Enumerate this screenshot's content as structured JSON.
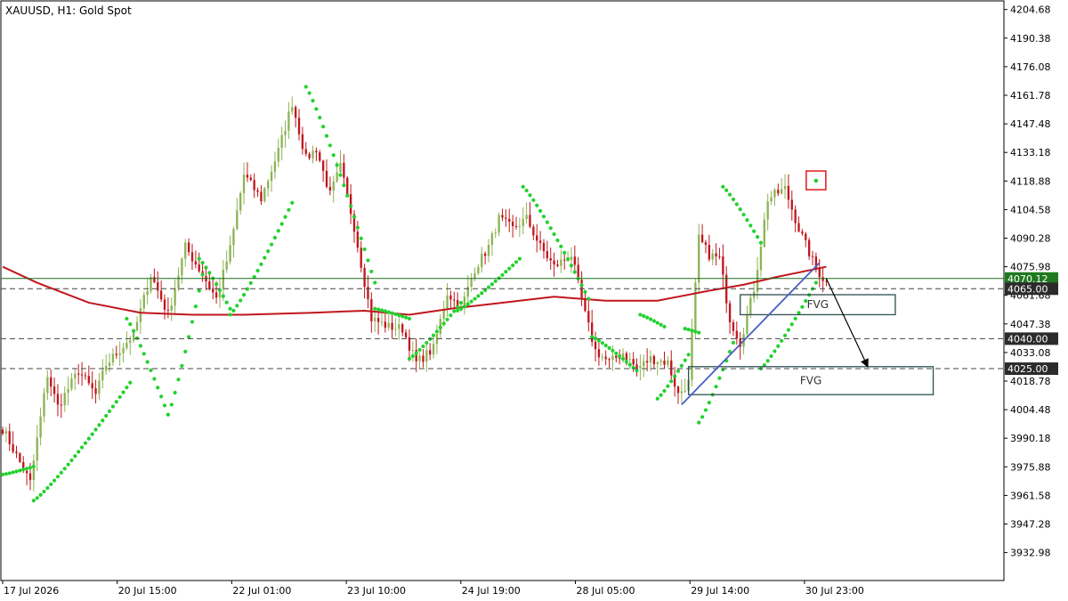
{
  "header": {
    "title": "XAUUSD, H1:  Gold Spot"
  },
  "colors": {
    "bull": "#8db355",
    "bear": "#c0161d",
    "sar": "#22d12e",
    "ma": "#c0161d",
    "trendline": "#4a5ec0",
    "hline": "#1b6b1b",
    "marker": "#e01818",
    "dashed": "#444444",
    "tag_green": "#1f7a1f",
    "tag_dark": "#2b2b2b"
  },
  "chart_data": {
    "type": "candlestick",
    "symbol": "XAUUSD",
    "timeframe": "H1",
    "ylim": [
      3919,
      4209
    ],
    "y_ticks": [
      3932.98,
      3947.28,
      3961.58,
      3975.88,
      3990.18,
      4004.48,
      4018.78,
      4033.08,
      4047.38,
      4061.68,
      4075.98,
      4090.28,
      4104.58,
      4118.88,
      4133.18,
      4147.48,
      4161.78,
      4176.08,
      4190.38,
      4204.68
    ],
    "x_labels": [
      "17 Jul 2026",
      "20 Jul 15:00",
      "22 Jul 01:00",
      "23 Jul 10:00",
      "24 Jul 19:00",
      "28 Jul 05:00",
      "29 Jul 14:00",
      "30 Jul 23:00"
    ],
    "key_points": [
      [
        0,
        3995
      ],
      [
        8,
        3968
      ],
      [
        13,
        4022
      ],
      [
        16,
        4006
      ],
      [
        22,
        4024
      ],
      [
        27,
        4012
      ],
      [
        30,
        4027
      ],
      [
        38,
        4042
      ],
      [
        43,
        4072
      ],
      [
        48,
        4052
      ],
      [
        53,
        4086
      ],
      [
        58,
        4072
      ],
      [
        62,
        4060
      ],
      [
        66,
        4085
      ],
      [
        70,
        4122
      ],
      [
        75,
        4110
      ],
      [
        80,
        4134
      ],
      [
        84,
        4158
      ],
      [
        88,
        4130
      ],
      [
        91,
        4135
      ],
      [
        95,
        4112
      ],
      [
        98,
        4126
      ],
      [
        102,
        4096
      ],
      [
        107,
        4050
      ],
      [
        112,
        4046
      ],
      [
        116,
        4045
      ],
      [
        120,
        4028
      ],
      [
        125,
        4035
      ],
      [
        129,
        4063
      ],
      [
        133,
        4055
      ],
      [
        137,
        4075
      ],
      [
        141,
        4086
      ],
      [
        144,
        4100
      ],
      [
        148,
        4095
      ],
      [
        152,
        4100
      ],
      [
        156,
        4086
      ],
      [
        160,
        4076
      ],
      [
        165,
        4082
      ],
      [
        169,
        4052
      ],
      [
        172,
        4034
      ],
      [
        176,
        4028
      ],
      [
        180,
        4033
      ],
      [
        184,
        4025
      ],
      [
        188,
        4030
      ],
      [
        193,
        4028
      ],
      [
        196,
        4012
      ],
      [
        199,
        4018
      ],
      [
        202,
        4090
      ],
      [
        205,
        4082
      ],
      [
        208,
        4080
      ],
      [
        211,
        4050
      ],
      [
        214,
        4038
      ],
      [
        218,
        4065
      ],
      [
        222,
        4110
      ],
      [
        227,
        4115
      ],
      [
        231,
        4095
      ],
      [
        236,
        4075
      ],
      [
        239,
        4068
      ]
    ],
    "sar_segments": [
      {
        "from": [
          0,
          3972
        ],
        "to": [
          9,
          3976
        ],
        "step": 0.6
      },
      {
        "from": [
          9,
          3959
        ],
        "to": [
          37,
          4018
        ],
        "step": 2.2
      },
      {
        "from": [
          36,
          4050
        ],
        "to": [
          48,
          4002
        ],
        "step": -2.5
      },
      {
        "from": [
          48,
          4002
        ],
        "to": [
          58,
          4072
        ],
        "step": 4.5
      },
      {
        "from": [
          57,
          4080
        ],
        "to": [
          66,
          4055
        ],
        "step": -1.2
      },
      {
        "from": [
          66,
          4052
        ],
        "to": [
          84,
          4108
        ],
        "step": 3.2
      },
      {
        "from": [
          88,
          4166
        ],
        "to": [
          108,
          4068
        ],
        "step": -3.5
      },
      {
        "from": [
          108,
          4055
        ],
        "to": [
          118,
          4050
        ],
        "step": -0.5
      },
      {
        "from": [
          118,
          4030
        ],
        "to": [
          133,
          4058
        ],
        "step": 1.6
      },
      {
        "from": [
          132,
          4054
        ],
        "to": [
          150,
          4080
        ],
        "step": 2.0
      },
      {
        "from": [
          151,
          4116
        ],
        "to": [
          170,
          4060
        ],
        "step": -3.0
      },
      {
        "from": [
          171,
          4041
        ],
        "to": [
          184,
          4024
        ],
        "step": -1.0
      },
      {
        "from": [
          185,
          4052
        ],
        "to": [
          192,
          4046
        ],
        "step": -0.6
      },
      {
        "from": [
          190,
          4010
        ],
        "to": [
          199,
          4032
        ],
        "step": 1.5
      },
      {
        "from": [
          198,
          4045
        ],
        "to": [
          202,
          4043
        ],
        "step": -0.4
      },
      {
        "from": [
          202,
          3998
        ],
        "to": [
          212,
          4038
        ],
        "step": 3.0
      },
      {
        "from": [
          209,
          4116
        ],
        "to": [
          220,
          4088
        ],
        "step": -2.2
      },
      {
        "from": [
          220,
          4025
        ],
        "to": [
          236,
          4068
        ],
        "step": 2.4
      }
    ],
    "sar_marker_point": [
      236,
      4119
    ],
    "moving_average": [
      [
        0,
        4076
      ],
      [
        10,
        4068
      ],
      [
        25,
        4058
      ],
      [
        40,
        4053
      ],
      [
        55,
        4052
      ],
      [
        70,
        4052
      ],
      [
        90,
        4053
      ],
      [
        105,
        4054
      ],
      [
        118,
        4052
      ],
      [
        130,
        4055
      ],
      [
        145,
        4058
      ],
      [
        160,
        4061
      ],
      [
        175,
        4059
      ],
      [
        190,
        4059
      ],
      [
        205,
        4064
      ],
      [
        215,
        4067
      ],
      [
        225,
        4071
      ],
      [
        239,
        4076
      ]
    ],
    "lines": {
      "green_h": 4070.12,
      "dashed": [
        4065.0,
        4040.0,
        4025.0
      ]
    },
    "trendline": {
      "from": [
        197,
        4007
      ],
      "to": [
        237,
        4078
      ]
    },
    "arrow": {
      "from": [
        239,
        4070
      ],
      "to": [
        251,
        4026
      ]
    },
    "fvg_boxes": [
      {
        "label": "FVG",
        "x0": 214,
        "x1": 259,
        "y_top": 4062,
        "y_bottom": 4052
      },
      {
        "label": "FVG",
        "x0": 199,
        "x1": 270,
        "y_top": 4026,
        "y_bottom": 4012
      }
    ],
    "price_tags": [
      {
        "label": "4070.12",
        "value": 4070.12,
        "style": "green"
      },
      {
        "label": "4065.00",
        "value": 4065.0,
        "style": "dark"
      },
      {
        "label": "4040.00",
        "value": 4040.0,
        "style": "dark"
      },
      {
        "label": "4025.00",
        "value": 4025.0,
        "style": "dark"
      }
    ]
  }
}
